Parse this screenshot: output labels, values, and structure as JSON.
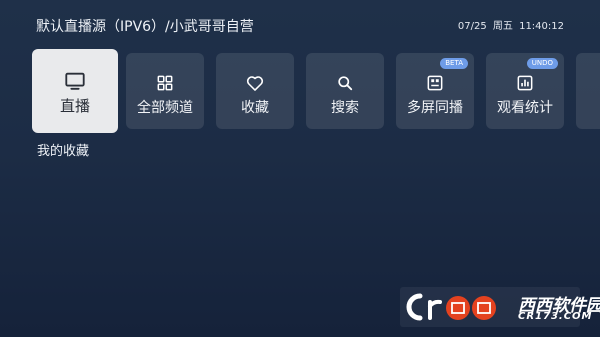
{
  "header": {
    "source_title": "默认直播源（IPV6）/小武哥哥自营",
    "date": "07/25",
    "weekday": "周五",
    "time": "11:40:12"
  },
  "menu": {
    "items": [
      {
        "label": "直播",
        "icon": "tv-icon",
        "active": true
      },
      {
        "label": "全部频道",
        "icon": "grid-icon",
        "active": false
      },
      {
        "label": "收藏",
        "icon": "heart-icon",
        "active": false
      },
      {
        "label": "搜索",
        "icon": "search-icon",
        "active": false
      },
      {
        "label": "多屏同播",
        "icon": "multi-screen-icon",
        "active": false,
        "badge": "BETA"
      },
      {
        "label": "观看统计",
        "icon": "chart-icon",
        "active": false,
        "badge": "UNDO"
      }
    ]
  },
  "section": {
    "title": "我的收藏"
  },
  "watermark": {
    "name": "西西软件园",
    "url": "CR173.COM"
  },
  "colors": {
    "background": "#1c2c45",
    "active_tile": "#e9eaec",
    "badge": "#6e9ce8"
  }
}
